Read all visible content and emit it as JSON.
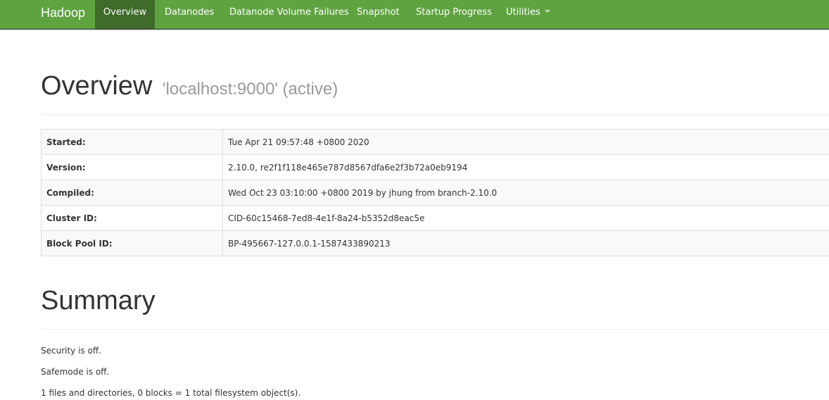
{
  "navbar": {
    "brand": "Hadoop",
    "items": [
      {
        "label": "Overview",
        "active": true
      },
      {
        "label": "Datanodes",
        "active": false
      },
      {
        "label": "Datanode Volume Failures",
        "active": false
      },
      {
        "label": "Snapshot",
        "active": false
      },
      {
        "label": "Startup Progress",
        "active": false
      },
      {
        "label": "Utilities",
        "active": false,
        "dropdown": true
      }
    ]
  },
  "overview": {
    "title": "Overview",
    "subtitle": "'localhost:9000' (active)",
    "rows": [
      {
        "label": "Started:",
        "value": "Tue Apr 21 09:57:48 +0800 2020"
      },
      {
        "label": "Version:",
        "value": "2.10.0, re2f1f118e465e787d8567dfa6e2f3b72a0eb9194"
      },
      {
        "label": "Compiled:",
        "value": "Wed Oct 23 03:10:00 +0800 2019 by jhung from branch-2.10.0"
      },
      {
        "label": "Cluster ID:",
        "value": "CID-60c15468-7ed8-4e1f-8a24-b5352d8eac5e"
      },
      {
        "label": "Block Pool ID:",
        "value": "BP-495667-127.0.0.1-1587433890213"
      }
    ]
  },
  "summary": {
    "title": "Summary",
    "lines": [
      "Security is off.",
      "Safemode is off.",
      "1 files and directories, 0 blocks = 1 total filesystem object(s)."
    ]
  },
  "colors": {
    "navbar_bg": "#5fa341",
    "navbar_active_bg": "#3f6b2b",
    "subtitle": "#999999"
  }
}
